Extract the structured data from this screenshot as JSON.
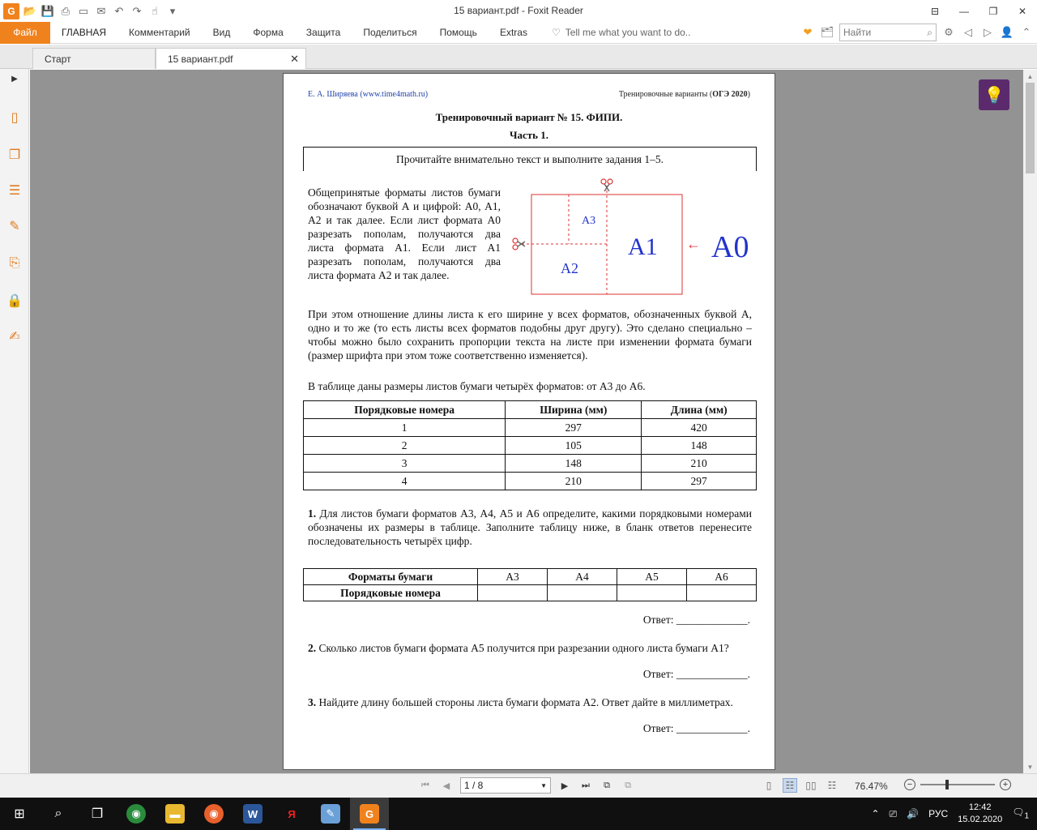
{
  "window": {
    "title": "15 вариант.pdf - Foxit Reader",
    "app_logo": "G",
    "minimize": "—",
    "maximize": "❐",
    "close": "✕"
  },
  "ribbon": {
    "file": "Файл",
    "items": [
      "ГЛАВНАЯ",
      "Комментарий",
      "Вид",
      "Форма",
      "Защита",
      "Поделиться",
      "Помощь",
      "Extras"
    ],
    "tellme": "Tell me what you want to do..",
    "search_placeholder": "Найти"
  },
  "tabs": {
    "start": "Старт",
    "current": "15 вариант.pdf",
    "close": "✕"
  },
  "page": {
    "header_left": "Е. А. Ширяева (www.time4math.ru)",
    "header_right_prefix": "Тренировочные варианты (",
    "header_right_bold": "ОГЭ 2020",
    "header_right_suffix": ")",
    "title": "Тренировочный вариант № 15. ФИПИ.",
    "part": "Часть 1.",
    "instruction": "Прочитайте внимательно текст и выполните задания 1–5.",
    "intro": "Общепринятые форматы листов бумаги обозначают буквой А и цифрой: А0, А1, А2 и так далее. Если лист формата А0 разрезать пополам, получаются два листа формата А1. Если лист А1 разрезать пополам, получаются два листа формата А2 и так далее.",
    "para1": "При этом отношение длины листа к его ширине у всех форматов, обозначенных буквой А, одно и то же (то есть листы всех форматов подобны друг другу). Это сделано специально – чтобы можно было сохранить пропорции текста на листе при изменении формата бумаги (размер шрифта при этом тоже соответственно изменяется).",
    "para2": "В таблице даны размеры листов бумаги четырёх форматов: от А3 до А6.",
    "diagram": {
      "a3": "А3",
      "a2": "А2",
      "a1": "А1",
      "a0": "А0",
      "arrow": "←"
    },
    "sizes_table": {
      "headers": [
        "Порядковые номера",
        "Ширина (мм)",
        "Длина (мм)"
      ],
      "rows": [
        [
          "1",
          "297",
          "420"
        ],
        [
          "2",
          "105",
          "148"
        ],
        [
          "3",
          "148",
          "210"
        ],
        [
          "4",
          "210",
          "297"
        ]
      ]
    },
    "q1_num": "1.",
    "q1": "Для листов бумаги форматов А3, А4, А5 и А6 определите, какими порядковыми номерами обозначены их размеры в таблице. Заполните таблицу ниже, в бланк ответов перенесите последовательность четырёх цифр.",
    "formats_table": {
      "row1_label": "Форматы бумаги",
      "formats": [
        "А3",
        "А4",
        "А5",
        "А6"
      ],
      "row2_label": "Порядковые номера"
    },
    "answer": "Ответ: _____________.",
    "q2_num": "2.",
    "q2": "Сколько листов бумаги формата А5 получится при разрезании одного листа бумаги А1?",
    "q3_num": "3.",
    "q3": "Найдите длину большей стороны листа бумаги формата А2. Ответ дайте в миллиметрах."
  },
  "statusbar": {
    "page_indicator": "1 / 8",
    "zoom": "76.47%",
    "zoom_level": 0.35
  },
  "taskbar": {
    "language": "РУС",
    "time": "12:42",
    "date": "15.02.2020",
    "notifications": "1"
  }
}
